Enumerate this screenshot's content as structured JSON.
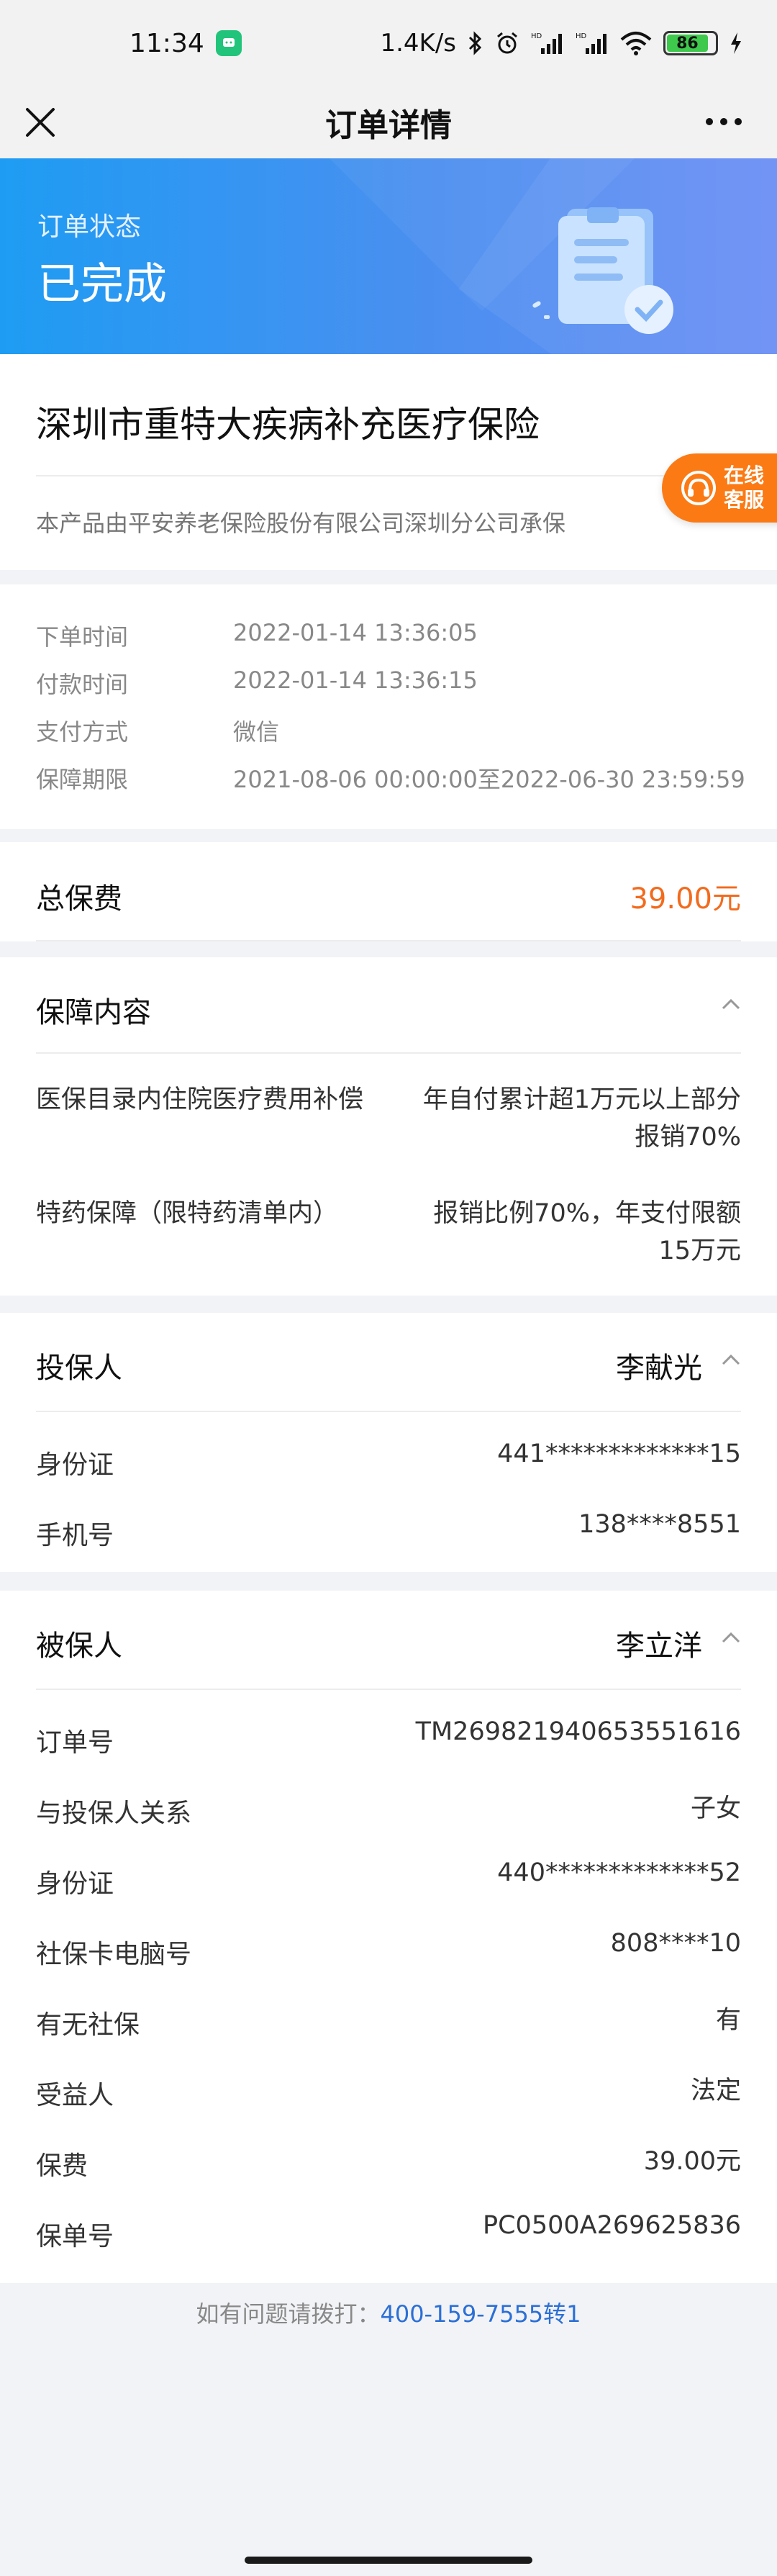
{
  "status_bar": {
    "time": "11:34",
    "network_speed": "1.4K/s",
    "battery": "86",
    "icons": [
      "chat-app-icon",
      "bluetooth-icon",
      "alarm-icon",
      "signal-hd-icon",
      "signal-hd-icon",
      "wifi-icon",
      "battery-icon",
      "charging-icon"
    ]
  },
  "nav": {
    "title": "订单详情",
    "close_icon": "close-icon",
    "more_icon": "more-icon"
  },
  "hero": {
    "label": "订单状态",
    "status": "已完成",
    "illustration": "clipboard-check-icon"
  },
  "product": {
    "title": "深圳市重特大疾病补充医疗保险",
    "underwriter": "本产品由平安养老保险股份有限公司深圳分公司承保"
  },
  "customer_service": {
    "line1": "在线",
    "line2": "客服",
    "icon": "headset-icon"
  },
  "order_info": [
    {
      "label": "下单时间",
      "value": "2022-01-14 13:36:05"
    },
    {
      "label": "付款时间",
      "value": "2022-01-14 13:36:15"
    },
    {
      "label": "支付方式",
      "value": "微信"
    },
    {
      "label": "保障期限",
      "value": "2021-08-06 00:00:00至2022-06-30 23:59:59"
    }
  ],
  "premium": {
    "label": "总保费",
    "value": "39.00元"
  },
  "coverage": {
    "title": "保障内容",
    "items": [
      {
        "name": "医保目录内住院医疗费用补偿",
        "value": "年自付累计超1万元以上部分报销70%"
      },
      {
        "name": "特药保障（限特药清单内）",
        "value": "报销比例70%，年支付限额15万元"
      }
    ]
  },
  "policyholder": {
    "title": "投保人",
    "name": "李献光",
    "fields": [
      {
        "label": "身份证",
        "value": "441*************15"
      },
      {
        "label": "手机号",
        "value": "138****8551"
      }
    ]
  },
  "insured": {
    "title": "被保人",
    "name": "李立洋",
    "fields": [
      {
        "label": "订单号",
        "value": "TM269821940653551616"
      },
      {
        "label": "与投保人关系",
        "value": "子女"
      },
      {
        "label": "身份证",
        "value": "440*************52"
      },
      {
        "label": "社保卡电脑号",
        "value": "808****10"
      },
      {
        "label": "有无社保",
        "value": "有"
      },
      {
        "label": "受益人",
        "value": "法定"
      },
      {
        "label": "保费",
        "value": "39.00元"
      },
      {
        "label": "保单号",
        "value": "PC0500A269625836"
      }
    ]
  },
  "footer": {
    "hint": "如有问题请拨打：",
    "phone": "400-159-7555转1"
  },
  "colors": {
    "accent_orange": "#f26b1d",
    "hero_blue": "#1e9cf3",
    "link_blue": "#2b6fd6"
  }
}
